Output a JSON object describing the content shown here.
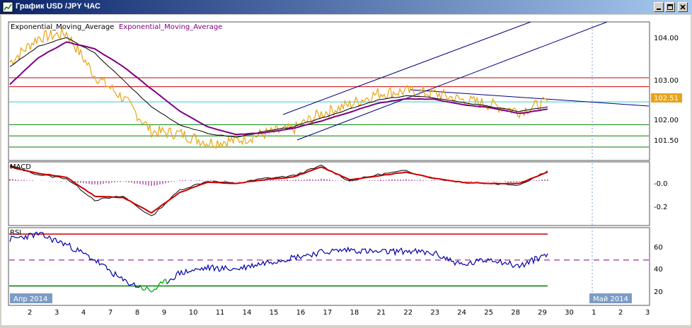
{
  "window": {
    "title": "График USD /JPY ЧАС",
    "icon": "chart-window-icon",
    "buttons": [
      "minimize",
      "restore",
      "close"
    ]
  },
  "colors": {
    "price": "#e8a317",
    "ema_fast": "#000000",
    "ema_slow": "#800080",
    "resistance": "#cc0000",
    "support": "#008000",
    "current": "#33cccc",
    "channel": "#000080",
    "macd_line": "#000000",
    "macd_signal": "#cc0000",
    "macd_hist": "#800080",
    "rsi": "#0000aa",
    "rsi_oversold": "#00cc00",
    "price_tag": "#e8a317"
  },
  "price_panel": {
    "legend": [
      "Exponential_Moving_Average",
      "Exponential_Moving_Average"
    ],
    "ticks": [
      "104.00",
      "103.00",
      "102.00",
      "101.50"
    ],
    "current_label": "102.51"
  },
  "macd_panel": {
    "label": "MACD",
    "ticks": [
      "-0.0",
      "-0.2"
    ]
  },
  "rsi_panel": {
    "label": "RSI",
    "ticks": [
      "60",
      "40",
      "20"
    ]
  },
  "x_axis": {
    "labels": [
      "2",
      "3",
      "4",
      "7",
      "8",
      "9",
      "10",
      "11",
      "14",
      "15",
      "16",
      "17",
      "18",
      "21",
      "22",
      "23",
      "24",
      "25",
      "28",
      "29",
      "30",
      "1",
      "2",
      "3"
    ],
    "month_labels": [
      "Апр 2014",
      "Май 2014"
    ]
  },
  "chart_data": [
    {
      "type": "line",
      "title": "USD/JPY H1",
      "legend": [
        "Exponential_Moving_Average",
        "Exponential_Moving_Average"
      ],
      "ylim": [
        101.2,
        104.3
      ],
      "x": [
        "2",
        "3",
        "4",
        "7",
        "8",
        "9",
        "10",
        "11",
        "14",
        "15",
        "16",
        "17",
        "18",
        "21",
        "22",
        "23",
        "24",
        "25",
        "28",
        "29"
      ],
      "series": [
        {
          "values": [
            103.4,
            103.95,
            104.05,
            103.1,
            102.6,
            101.85,
            101.8,
            101.6,
            101.65,
            101.8,
            101.9,
            102.25,
            102.45,
            102.7,
            102.75,
            102.7,
            102.55,
            102.45,
            102.3,
            102.51
          ]
        },
        {
          "values": [
            103.3,
            103.75,
            103.95,
            103.6,
            103.0,
            102.4,
            102.0,
            101.8,
            101.72,
            101.85,
            101.95,
            102.15,
            102.35,
            102.55,
            102.65,
            102.6,
            102.5,
            102.4,
            102.3,
            102.4
          ]
        },
        {
          "values": [
            102.9,
            103.5,
            103.85,
            103.7,
            103.3,
            102.8,
            102.3,
            101.95,
            101.78,
            101.82,
            101.92,
            102.08,
            102.28,
            102.48,
            102.58,
            102.57,
            102.45,
            102.38,
            102.25,
            102.35
          ]
        }
      ],
      "levels": [
        103.05,
        102.85,
        102.51,
        102.0,
        101.75,
        101.5
      ]
    },
    {
      "type": "line",
      "legend": [
        "MACD"
      ],
      "ylim": [
        -0.35,
        0.15
      ],
      "yticks": [
        -0.0,
        -0.2
      ],
      "series": [
        {
          "values": [
            0.12,
            0.05,
            0.02,
            -0.15,
            -0.12,
            -0.28,
            -0.07,
            0.0,
            -0.02,
            0.02,
            0.04,
            0.12,
            0.0,
            0.05,
            0.08,
            0.02,
            -0.01,
            -0.02,
            -0.03,
            0.08
          ]
        },
        {
          "values": [
            0.11,
            0.06,
            0.03,
            -0.12,
            -0.13,
            -0.25,
            -0.09,
            -0.01,
            -0.02,
            0.01,
            0.03,
            0.11,
            0.01,
            0.04,
            0.07,
            0.02,
            -0.01,
            -0.02,
            -0.02,
            0.07
          ]
        }
      ]
    },
    {
      "type": "line",
      "legend": [
        "RSI"
      ],
      "ylim": [
        15,
        75
      ],
      "yticks": [
        60,
        40,
        20
      ],
      "levels": [
        70,
        50,
        30
      ],
      "series": [
        {
          "values": [
            66,
            70,
            62,
            50,
            34,
            26,
            40,
            44,
            43,
            48,
            52,
            56,
            58,
            56,
            57,
            55,
            46,
            51,
            45,
            55
          ]
        }
      ]
    }
  ]
}
